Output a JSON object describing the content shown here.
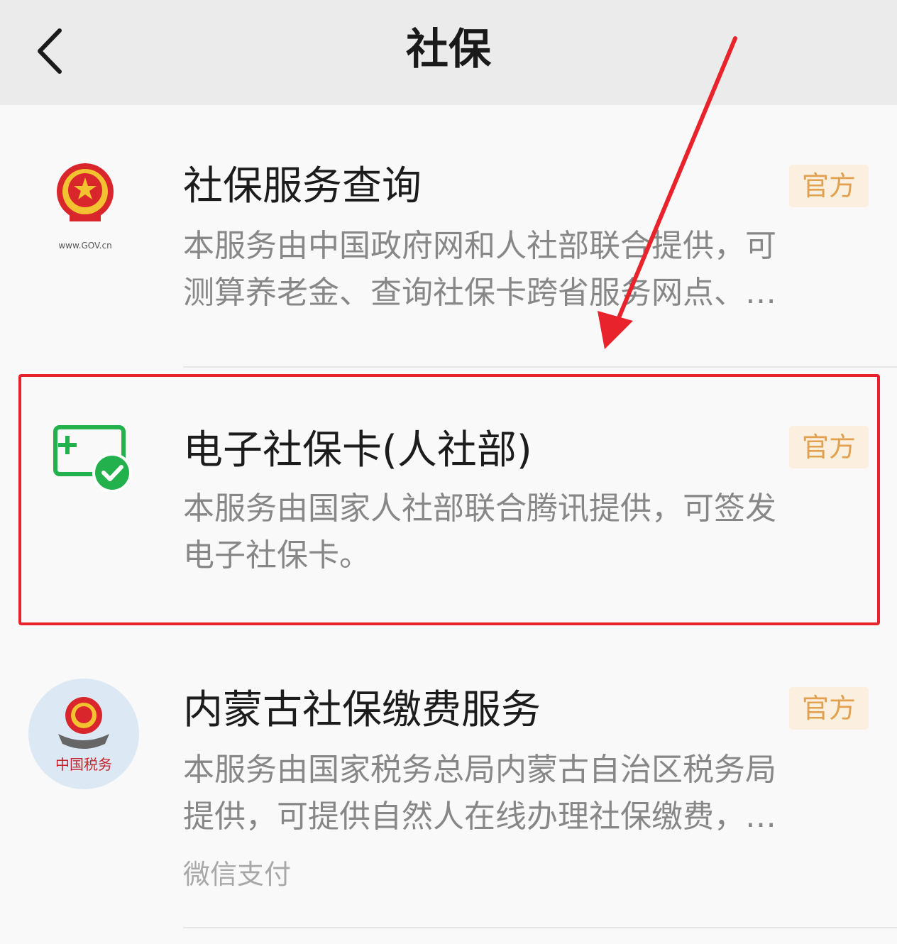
{
  "header": {
    "title": "社保",
    "back_icon": "chevron-left-icon"
  },
  "items": [
    {
      "title": "社保服务查询",
      "badge": "官方",
      "desc_lines": [
        "本服务由中国政府网和人社部联合提供，可",
        "测算养老金、查询社保卡跨省服务网点、…"
      ],
      "icon": "gov-emblem-icon",
      "icon_caption": "www.GOV.cn"
    },
    {
      "title": "电子社保卡(人社部)",
      "badge": "官方",
      "desc_lines": [
        "本服务由国家人社部联合腾讯提供，可签发",
        "电子社保卡。"
      ],
      "icon": "e-social-card-icon"
    },
    {
      "title": "内蒙古社保缴费服务",
      "badge": "官方",
      "desc_lines": [
        "本服务由国家税务总局内蒙古自治区税务局",
        "提供，可提供自然人在线办理社保缴费，…"
      ],
      "source": "微信支付",
      "icon": "china-tax-emblem-icon",
      "icon_caption": "中国税务"
    }
  ],
  "colors": {
    "badge_bg": "#fbf0e0",
    "badge_text": "#e1a14e",
    "highlight": "#e8232b",
    "icon_green": "#22b14c"
  }
}
